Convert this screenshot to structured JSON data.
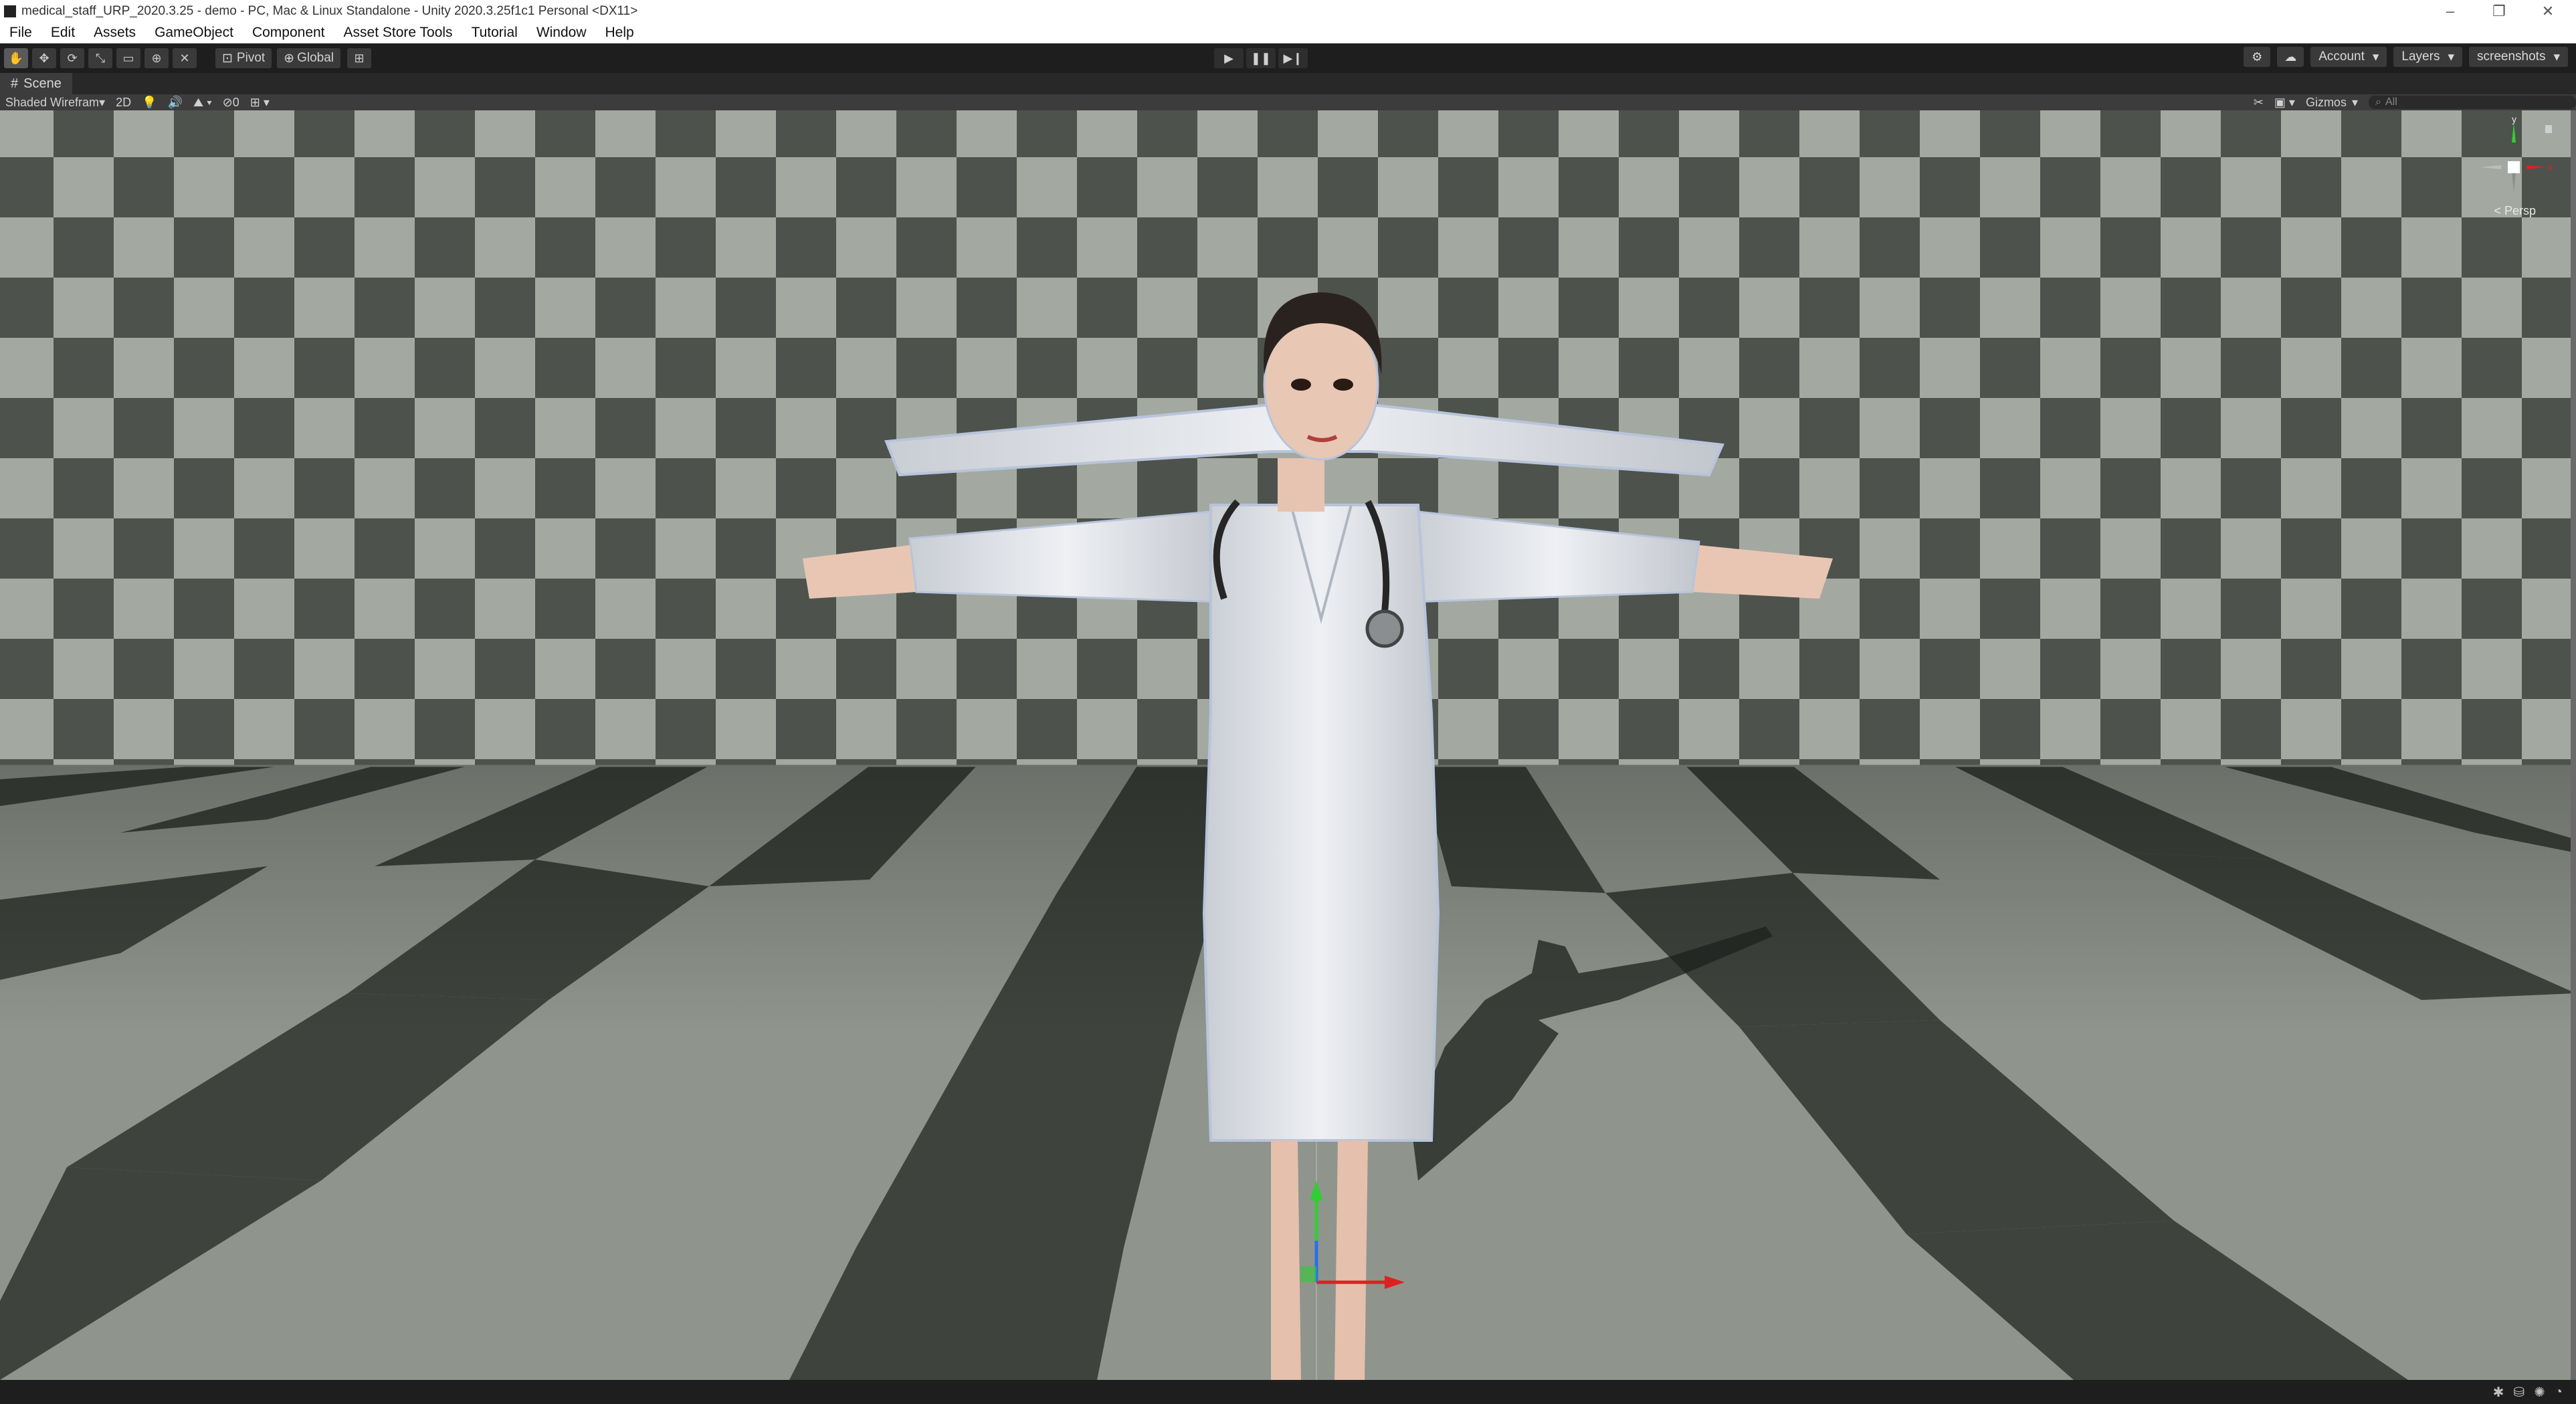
{
  "window": {
    "title": "medical_staff_URP_2020.3.25 - demo - PC, Mac & Linux Standalone - Unity 2020.3.25f1c1 Personal <DX11>",
    "controls": [
      "–",
      "❐",
      "✕"
    ]
  },
  "menu": [
    "File",
    "Edit",
    "Assets",
    "GameObject",
    "Component",
    "Asset Store Tools",
    "Tutorial",
    "Window",
    "Help"
  ],
  "toolbar": {
    "tools": [
      {
        "icon": "hand-tool-icon",
        "glyph": "✋"
      },
      {
        "icon": "move-tool-icon",
        "glyph": "✥"
      },
      {
        "icon": "rotate-tool-icon",
        "glyph": "⟳"
      },
      {
        "icon": "scale-tool-icon",
        "glyph": "⤡"
      },
      {
        "icon": "rect-tool-icon",
        "glyph": "▭"
      },
      {
        "icon": "transform-tool-icon",
        "glyph": "⊕"
      },
      {
        "icon": "custom-tool-icon",
        "glyph": "✕"
      }
    ],
    "pivot_label": "Pivot",
    "global_label": "Global",
    "account_label": "Account",
    "layers_label": "Layers",
    "layout_label": "screenshots"
  },
  "scene_tab": {
    "label": "Scene"
  },
  "scene_toolbar": {
    "shading_mode": "Shaded Wirefram",
    "mode_2d": "2D",
    "hidden_count": "0",
    "gizmos_label": "Gizmos",
    "search_placeholder": "All"
  },
  "viewport": {
    "camera_label": "< Persp",
    "axis_y": "y",
    "axis_x": "x"
  },
  "colors": {
    "checker_dark": "#4d524c",
    "checker_light": "#a3a9a1",
    "axis_x": "#e02020",
    "axis_y": "#33cc33",
    "axis_z": "#2a6ff0"
  }
}
